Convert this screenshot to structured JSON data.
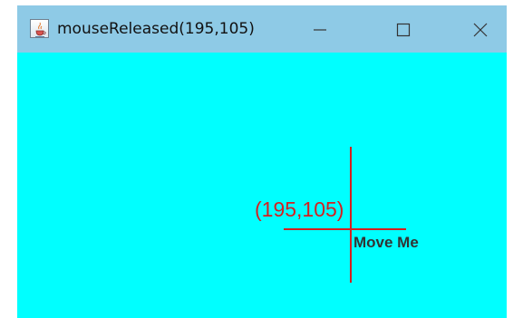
{
  "window": {
    "title": "mouseReleased(195,105)",
    "app_icon": "java-cup-icon",
    "controls": {
      "minimize_icon": "minimize-icon",
      "maximize_icon": "maximize-icon",
      "close_icon": "close-icon"
    },
    "titlebar_color": "#8ecae6"
  },
  "canvas": {
    "background_color": "#00ffff",
    "crosshair_color": "#d42020",
    "coordinate_label": "(195,105)",
    "draggable_label": "Move Me",
    "draggable_color": "#333333"
  }
}
